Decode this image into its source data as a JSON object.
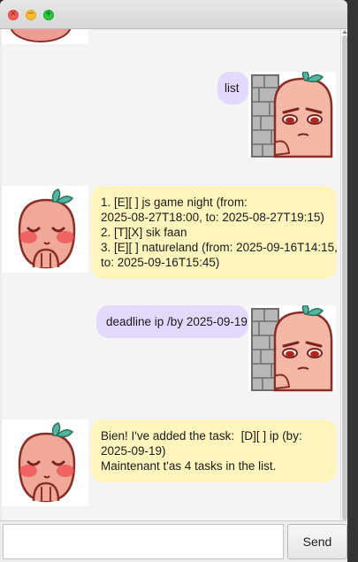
{
  "window": {
    "controls": [
      "close",
      "minimize",
      "zoom"
    ]
  },
  "conversation": [
    {
      "sender": "user",
      "avatar": "peeking-character",
      "lines": [
        "list"
      ]
    },
    {
      "sender": "bot",
      "avatar": "blushing-character",
      "lines": [
        "1. [E][ ] js game night (from:",
        "2025-08-27T18:00, to: 2025-08-27T19:15)",
        "2. [T][X] sik faan",
        "3. [E][ ] natureland (from: 2025-09-16T14:15,",
        "to: 2025-09-16T15:45)"
      ]
    },
    {
      "sender": "user",
      "avatar": "peeking-character",
      "lines": [
        "deadline ip /by 2025-09-19"
      ]
    },
    {
      "sender": "bot",
      "avatar": "blushing-character",
      "lines": [
        "Bien! I've added the task:  [D][ ] ip (by:",
        "2025-09-19)",
        "Maintenant t'as 4 tasks in the list."
      ]
    }
  ],
  "input": {
    "value": "",
    "placeholder": ""
  },
  "send_button": {
    "label": "Send"
  },
  "colors": {
    "user_bubble": "#e3d9fc",
    "bot_bubble": "#fff5bd",
    "accent_blue": "#3b8fd9"
  }
}
